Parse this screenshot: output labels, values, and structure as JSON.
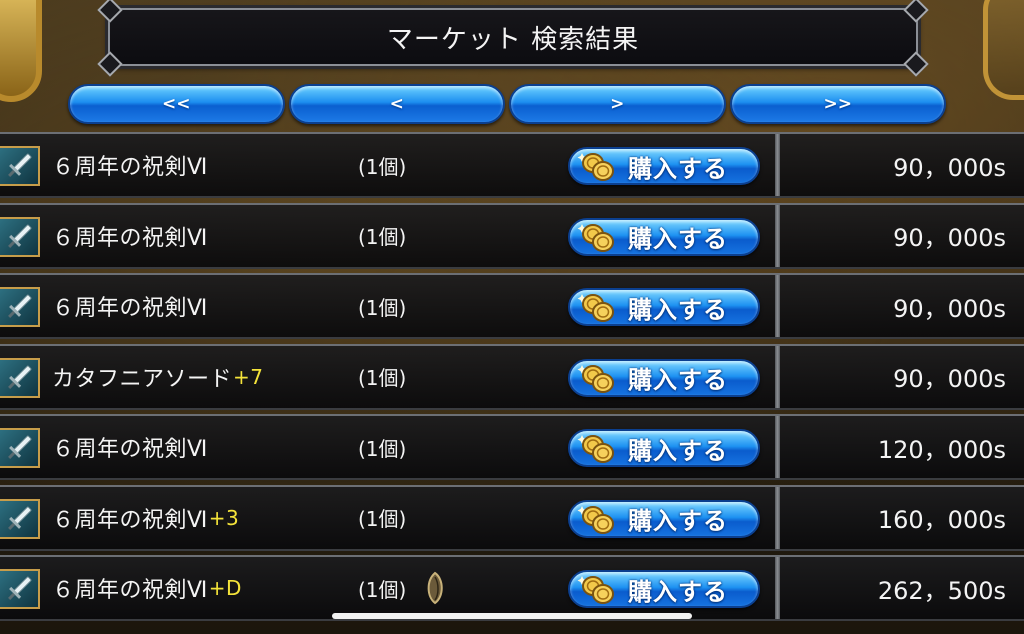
{
  "title": "マーケット 検索結果",
  "nav": {
    "first": "<<",
    "prev": "<",
    "next": ">",
    "last": ">>"
  },
  "rows": [
    {
      "name": "６周年の祝剣Ⅵ",
      "plus": "",
      "qty": "(1個)",
      "buy_label": "購入する",
      "price": "90，000s",
      "icon": "sword-icon",
      "extra_icon": ""
    },
    {
      "name": "６周年の祝剣Ⅵ",
      "plus": "",
      "qty": "(1個)",
      "buy_label": "購入する",
      "price": "90，000s",
      "icon": "sword-icon",
      "extra_icon": ""
    },
    {
      "name": "６周年の祝剣Ⅵ",
      "plus": "",
      "qty": "(1個)",
      "buy_label": "購入する",
      "price": "90，000s",
      "icon": "sword-icon",
      "extra_icon": ""
    },
    {
      "name": "カタフニアソード",
      "plus": "+7",
      "qty": "(1個)",
      "buy_label": "購入する",
      "price": "90，000s",
      "icon": "sword-icon",
      "extra_icon": ""
    },
    {
      "name": "６周年の祝剣Ⅵ",
      "plus": "",
      "qty": "(1個)",
      "buy_label": "購入する",
      "price": "120，000s",
      "icon": "sword-icon",
      "extra_icon": ""
    },
    {
      "name": "６周年の祝剣Ⅵ",
      "plus": "+3",
      "qty": "(1個)",
      "buy_label": "購入する",
      "price": "160，000s",
      "icon": "sword-icon",
      "extra_icon": ""
    },
    {
      "name": "６周年の祝剣Ⅵ",
      "plus": "+D",
      "qty": "(1個)",
      "buy_label": "購入する",
      "price": "262，500s",
      "icon": "sword-icon",
      "extra_icon": "seed-icon"
    }
  ],
  "colors": {
    "plus_text": "#f4e33a",
    "button_blue": "#1e92f2",
    "frame_gold": "#c79d4a"
  }
}
